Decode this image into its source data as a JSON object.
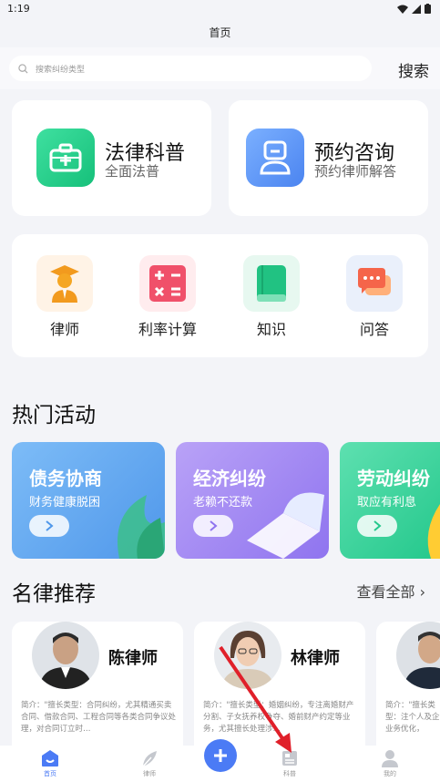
{
  "status_bar": {
    "time": "1:19"
  },
  "header": {
    "title": "首页"
  },
  "search": {
    "placeholder": "搜索纠纷类型",
    "button_label": "搜索"
  },
  "feature_cards": [
    {
      "title": "法律科普",
      "subtitle": "全面法普"
    },
    {
      "title": "预约咨询",
      "subtitle": "预约律师解答"
    }
  ],
  "tools": [
    {
      "label": "律师"
    },
    {
      "label": "利率计算"
    },
    {
      "label": "知识"
    },
    {
      "label": "问答"
    }
  ],
  "activities": {
    "title": "热门活动",
    "banners": [
      {
        "title": "债务协商",
        "subtitle": "财务健康脱困",
        "color": "#5ea5ee"
      },
      {
        "title": "经济纠纷",
        "subtitle": "老赖不还款",
        "color": "#a58cf3"
      },
      {
        "title": "劳动纠纷",
        "subtitle": "取应有利息",
        "color": "#2fcf9a"
      }
    ]
  },
  "lawyers": {
    "title": "名律推荐",
    "view_all": "查看全部",
    "items": [
      {
        "name": "陈律师",
        "desc": "简介：\"擅长类型：合同纠纷，尤其精通买卖合同、借款合同、工程合同等各类合同争议处理，对合同订立时…"
      },
      {
        "name": "林律师",
        "desc": "简介：\"擅长类型：婚姻纠纷，专注离婚财产分割、子女抚养权争夺、婚前财产约定等业务，尤其擅长处理涉…"
      },
      {
        "name": "",
        "desc": "简介：\"擅长类型：注个人及企业务优化，"
      }
    ]
  },
  "tabbar": {
    "items": [
      {
        "label": "首页",
        "active": true
      },
      {
        "label": "律师",
        "active": false
      },
      {
        "label": "科普",
        "active": false
      },
      {
        "label": "我的",
        "active": false
      }
    ]
  }
}
